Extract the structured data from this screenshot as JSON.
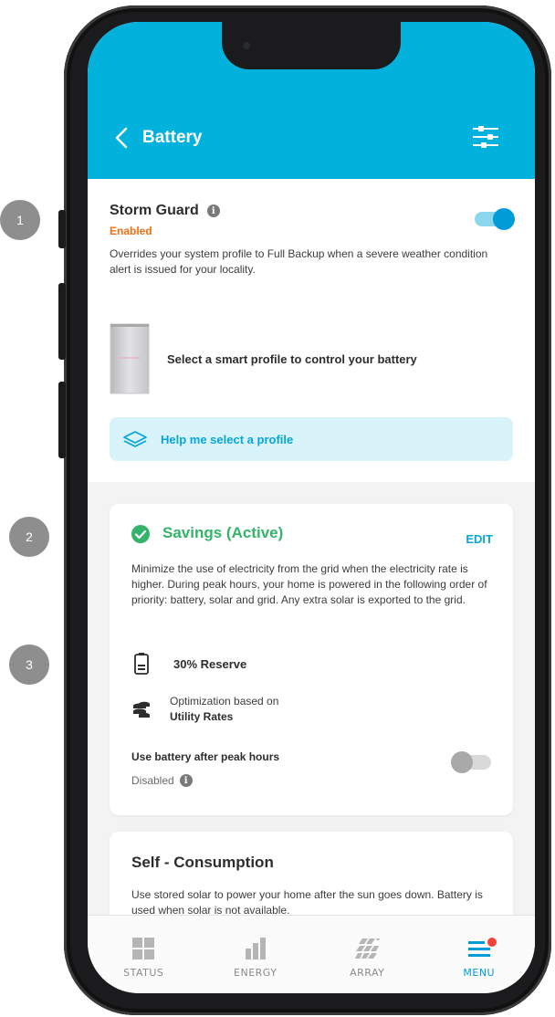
{
  "markers": [
    "1",
    "2",
    "3"
  ],
  "header": {
    "title": "Battery",
    "back_icon": "chevron-left-icon",
    "settings_icon": "sliders-icon",
    "background": "#03b1dd"
  },
  "storm_guard": {
    "title": "Storm Guard",
    "status": "Enabled",
    "status_color": "#f56e0f",
    "description": "Overrides your system profile to Full Backup when a severe weather condition alert is issued for your locality.",
    "toggle_on": true
  },
  "profile": {
    "prompt": "Select a smart profile to control your battery",
    "help_label": "Help me select a profile"
  },
  "savings": {
    "title": "Savings (Active)",
    "edit_label": "EDIT",
    "description": "Minimize the use of electricity from the grid when the electricity rate is higher. During peak hours, your home is powered in the following order of priority: battery, solar and grid. Any extra solar is exported to the grid.",
    "reserve": "30% Reserve",
    "optimization_label": "Optimization based on",
    "optimization_value": "Utility Rates",
    "peak_label": "Use battery after peak hours",
    "peak_status": "Disabled",
    "peak_toggle_on": false,
    "accent": "#34b36a"
  },
  "self_consumption": {
    "title": "Self - Consumption",
    "description": "Use stored solar to power your home after the sun goes down. Battery is used when solar is not available."
  },
  "tabs": [
    {
      "label": "STATUS",
      "icon": "grid-icon",
      "active": false
    },
    {
      "label": "ENERGY",
      "icon": "bar-chart-icon",
      "active": false
    },
    {
      "label": "ARRAY",
      "icon": "solar-array-icon",
      "active": false
    },
    {
      "label": "MENU",
      "icon": "menu-icon",
      "active": true
    }
  ]
}
